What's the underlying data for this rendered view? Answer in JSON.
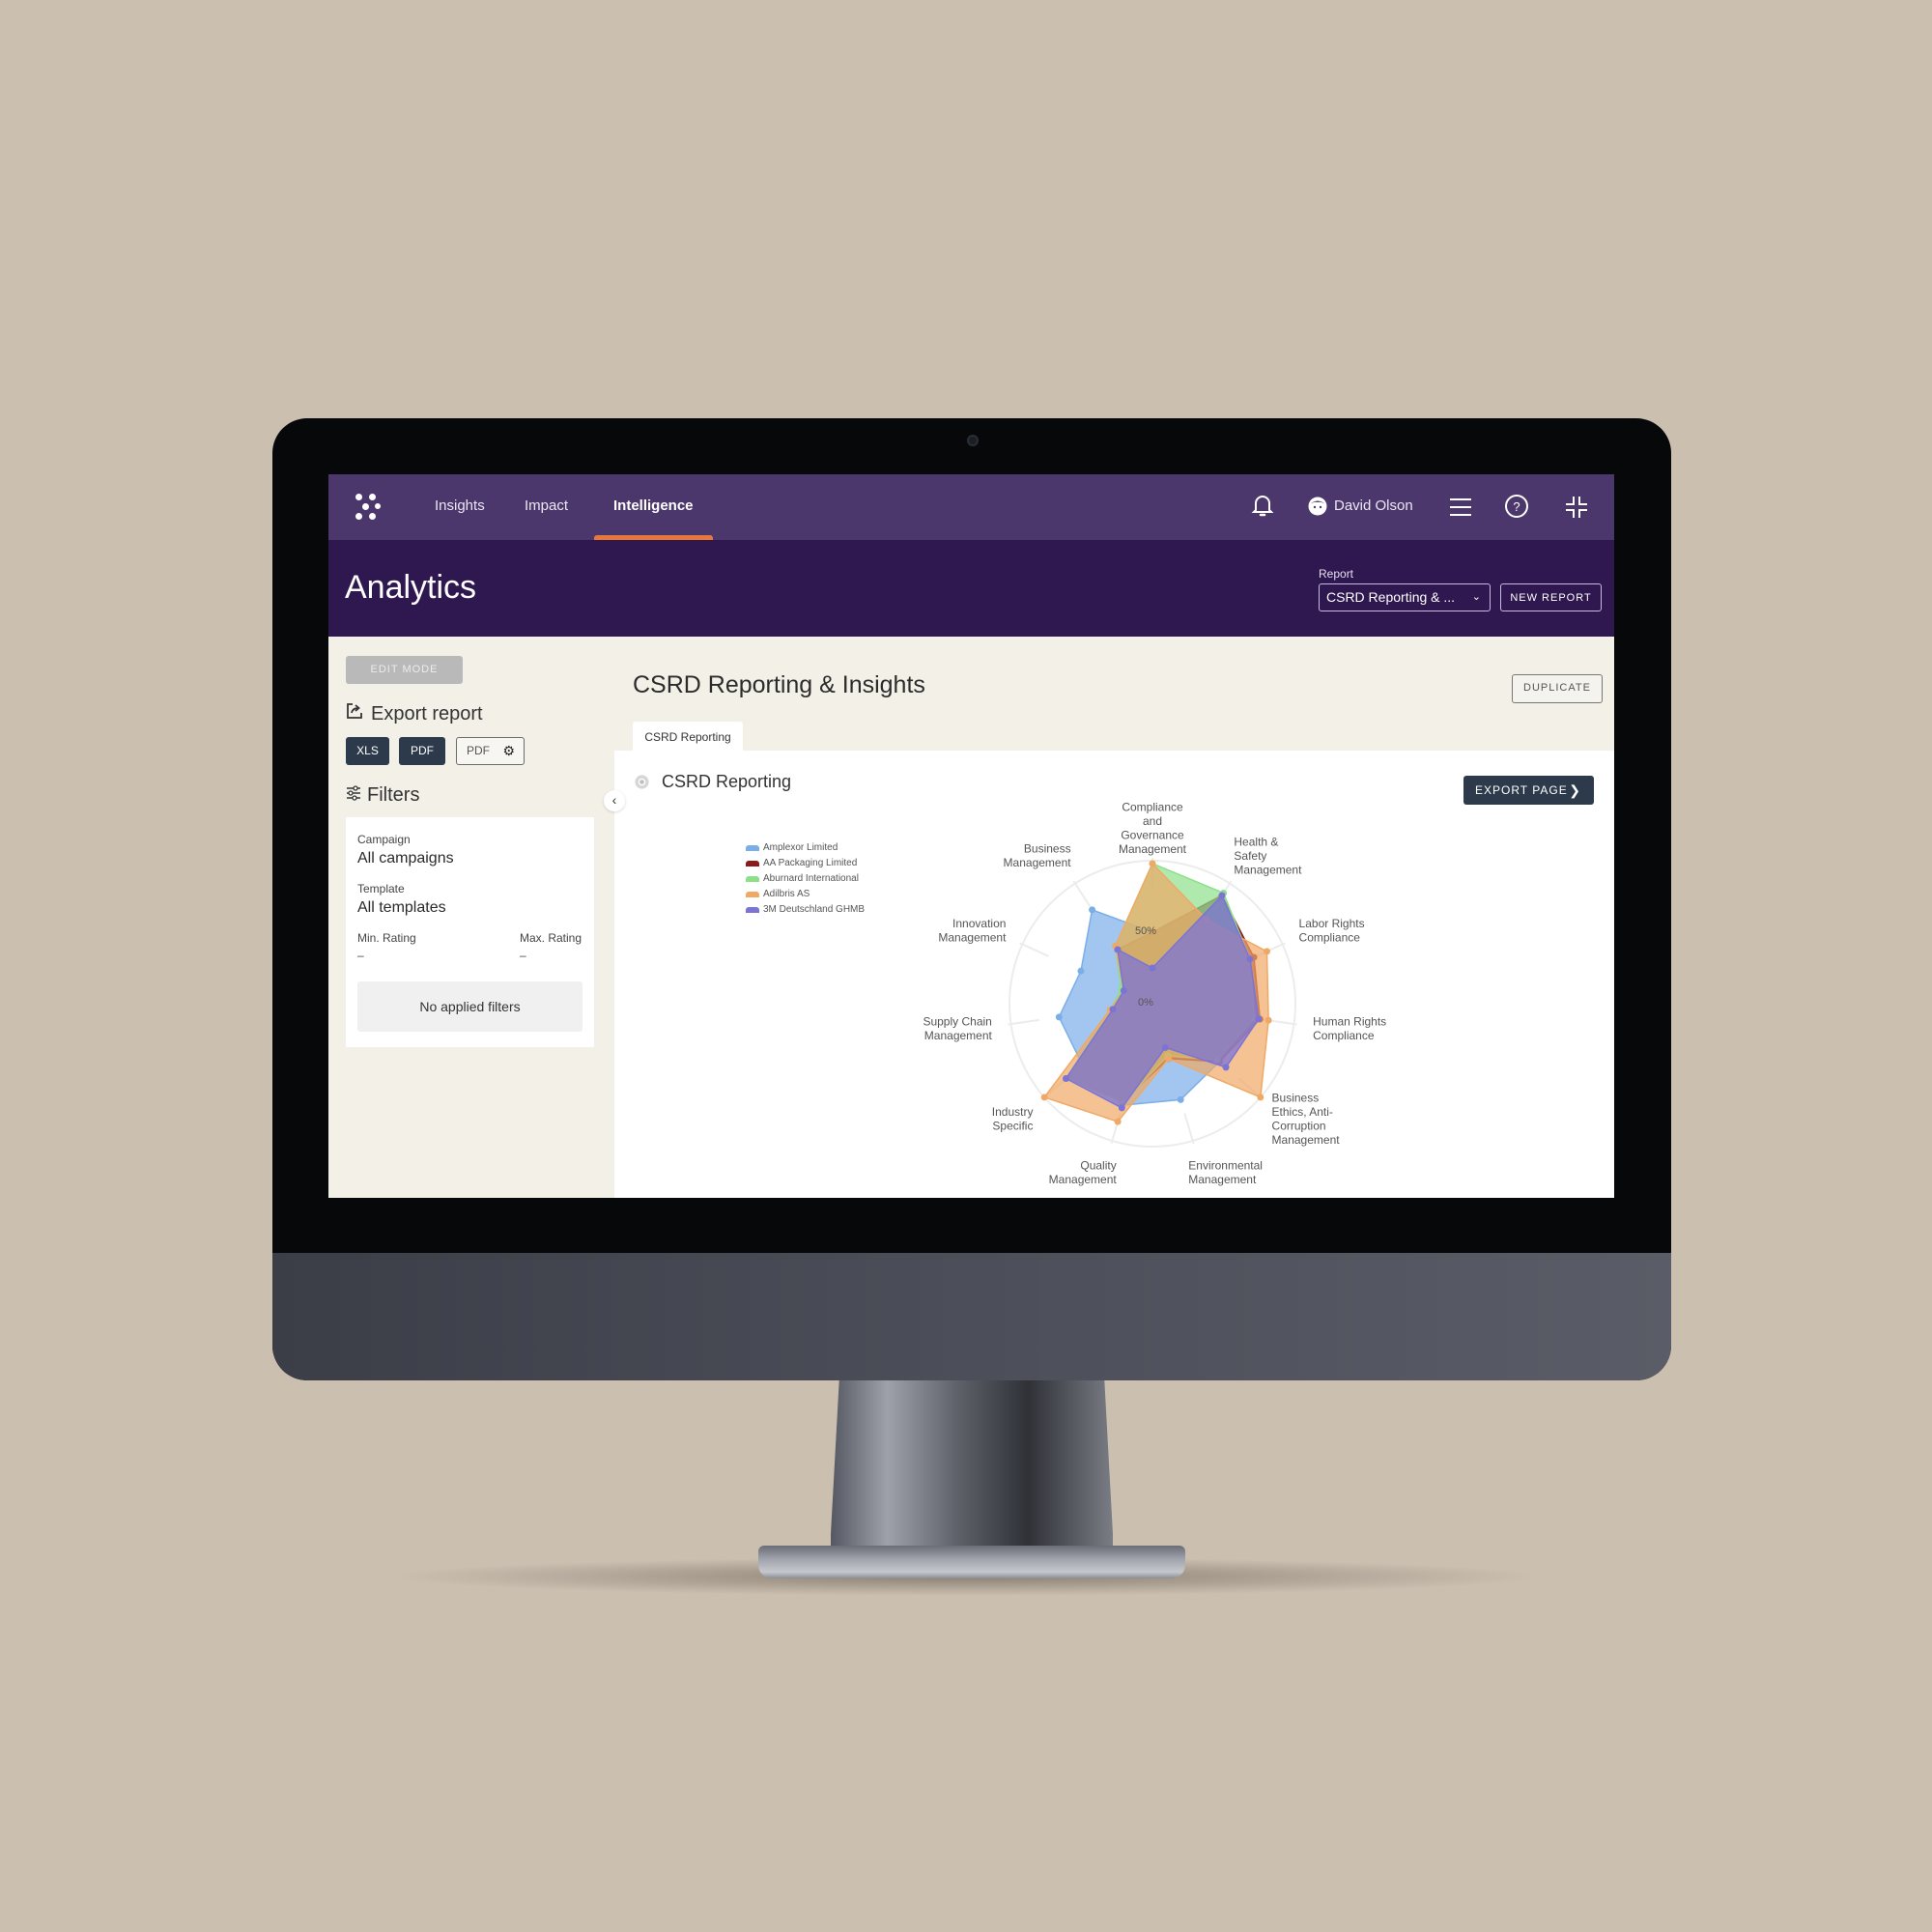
{
  "nav": {
    "items": [
      {
        "label": "Insights",
        "active": false
      },
      {
        "label": "Impact",
        "active": false
      },
      {
        "label": "Intelligence",
        "active": true
      }
    ],
    "accent_color": "#e8773c",
    "user_name": "David Olson",
    "icons": [
      "bell-icon",
      "user-avatar-icon",
      "hamburger-menu-icon",
      "help-icon",
      "collapse-screen-icon"
    ]
  },
  "header": {
    "title": "Analytics",
    "report_label": "Report",
    "report_value": "CSRD Reporting & ...",
    "new_report": "NEW REPORT"
  },
  "sidebar": {
    "edit_mode": "EDIT MODE",
    "export_title": "Export report",
    "export_buttons": {
      "xls": "XLS",
      "pdf": "PDF",
      "pdf_settings": "PDF"
    },
    "filters_title": "Filters",
    "filters": {
      "campaign_label": "Campaign",
      "campaign_value": "All campaigns",
      "template_label": "Template",
      "template_value": "All templates",
      "min_rating_label": "Min. Rating",
      "min_rating_value": "–",
      "max_rating_label": "Max. Rating",
      "max_rating_value": "–",
      "empty_state": "No applied filters"
    }
  },
  "main": {
    "title": "CSRD Reporting & Insights",
    "duplicate": "DUPLICATE",
    "tabs": [
      {
        "label": "CSRD Reporting",
        "active": true
      }
    ],
    "panel_title": "CSRD Reporting",
    "export_page": "EXPORT PAGE"
  },
  "chart_data": {
    "type": "radar",
    "title": "",
    "axes": [
      "Compliance and Governance Management",
      "Health & Safety Management",
      "Labor Rights Compliance",
      "Human Rights Compliance",
      "Business Ethics, Anti-Corruption Management",
      "Environmental Management",
      "Quality Management",
      "Industry Specific",
      "Supply Chain Management",
      "Innovation Management",
      "Business Management"
    ],
    "axis_label_lines": [
      [
        "Compliance",
        "and",
        "Governance",
        "Management"
      ],
      [
        "Health &",
        "Safety",
        "Management"
      ],
      [
        "Labor Rights",
        "Compliance"
      ],
      [
        "Human Rights",
        "Compliance"
      ],
      [
        "Business",
        "Ethics, Anti-",
        "Corruption",
        "Management"
      ],
      [
        "Environmental",
        "Management"
      ],
      [
        "Quality",
        "Management"
      ],
      [
        "Industry",
        "Specific"
      ],
      [
        "Supply Chain",
        "Management"
      ],
      [
        "Innovation",
        "Management"
      ],
      [
        "Business",
        "Management"
      ]
    ],
    "tick_labels": [
      "0%",
      "50%"
    ],
    "range": [
      0,
      100
    ],
    "legend_position": "top-left",
    "series": [
      {
        "name": "Amplexor Limited",
        "color": "#7aaee8",
        "values": [
          50,
          88,
          78,
          76,
          62,
          70,
          74,
          65,
          66,
          55,
          78
        ]
      },
      {
        "name": "AA Packaging Limited",
        "color": "#8b1a1a",
        "values": [
          50,
          90,
          78,
          76,
          62,
          40,
          70,
          80,
          28,
          22,
          45
        ]
      },
      {
        "name": "Aburnard International",
        "color": "#8de08a",
        "values": [
          98,
          92,
          75,
          72,
          60,
          38,
          72,
          80,
          30,
          24,
          48
        ]
      },
      {
        "name": "Adilbris AS",
        "color": "#f0a865",
        "values": [
          98,
          70,
          88,
          82,
          100,
          40,
          86,
          100,
          30,
          22,
          48
        ]
      },
      {
        "name": "3M Deutschland GHMB",
        "color": "#7b74d6",
        "values": [
          25,
          90,
          75,
          75,
          68,
          32,
          76,
          80,
          28,
          22,
          45
        ]
      }
    ]
  }
}
